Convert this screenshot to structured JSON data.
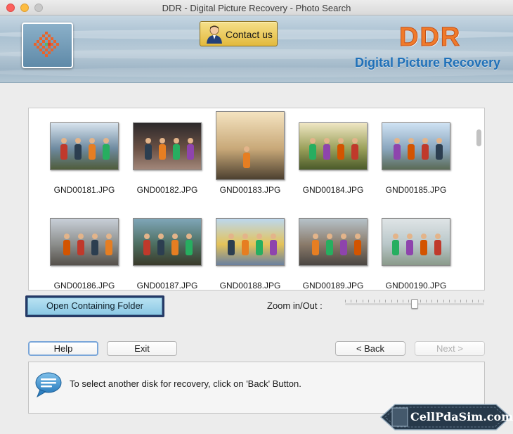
{
  "window": {
    "title": "DDR - Digital Picture Recovery - Photo Search"
  },
  "header": {
    "contact_label": "Contact us",
    "brand": "DDR",
    "brand_sub": "Digital Picture Recovery",
    "colors": {
      "brand_orange": "#f07a2a",
      "brand_blue": "#1f70b8"
    }
  },
  "gallery": {
    "items": [
      {
        "name": "GND00181.JPG",
        "colors": [
          "#d7e3ee",
          "#6e8aa0",
          "#4f5c3a"
        ],
        "selected": false
      },
      {
        "name": "GND00182.JPG",
        "colors": [
          "#2d2a2c",
          "#6a5044",
          "#a2877a"
        ],
        "selected": false
      },
      {
        "name": "GND00183.JPG",
        "colors": [
          "#f4e3c0",
          "#c8a878",
          "#4c4030"
        ],
        "selected": true
      },
      {
        "name": "GND00184.JPG",
        "colors": [
          "#efe6c3",
          "#9aa05a",
          "#4a5a2a"
        ],
        "selected": false
      },
      {
        "name": "GND00185.JPG",
        "colors": [
          "#cfe2f3",
          "#8aa6be",
          "#5a6a55"
        ],
        "selected": false
      },
      {
        "name": "GND00186.JPG",
        "colors": [
          "#c8cfd8",
          "#8c8e8c",
          "#55504a"
        ],
        "selected": false
      },
      {
        "name": "GND00187.JPG",
        "colors": [
          "#7fa6b8",
          "#4d6e60",
          "#3a3a2a"
        ],
        "selected": false
      },
      {
        "name": "GND00188.JPG",
        "colors": [
          "#bcd8ee",
          "#e4c35a",
          "#6a80a0"
        ],
        "selected": false
      },
      {
        "name": "GND00189.JPG",
        "colors": [
          "#b6c2c9",
          "#8a7a6a",
          "#4a4642"
        ],
        "selected": false
      },
      {
        "name": "GND00190.JPG",
        "colors": [
          "#dfe4e6",
          "#b9c7c9",
          "#8a9a8a"
        ],
        "selected": false
      }
    ]
  },
  "actions": {
    "open_folder": "Open Containing Folder",
    "zoom_label": "Zoom in/Out :",
    "zoom_level": 0.5,
    "help": "Help",
    "exit": "Exit",
    "back": "< Back",
    "next": "Next >"
  },
  "message": {
    "text": "To select another disk for recovery, click on 'Back' Button."
  },
  "watermark": {
    "text": "CellPdaSim.com"
  },
  "icons": {
    "logo": "checker-logo-icon",
    "contact": "person-icon",
    "message": "speech-bubble-icon"
  }
}
